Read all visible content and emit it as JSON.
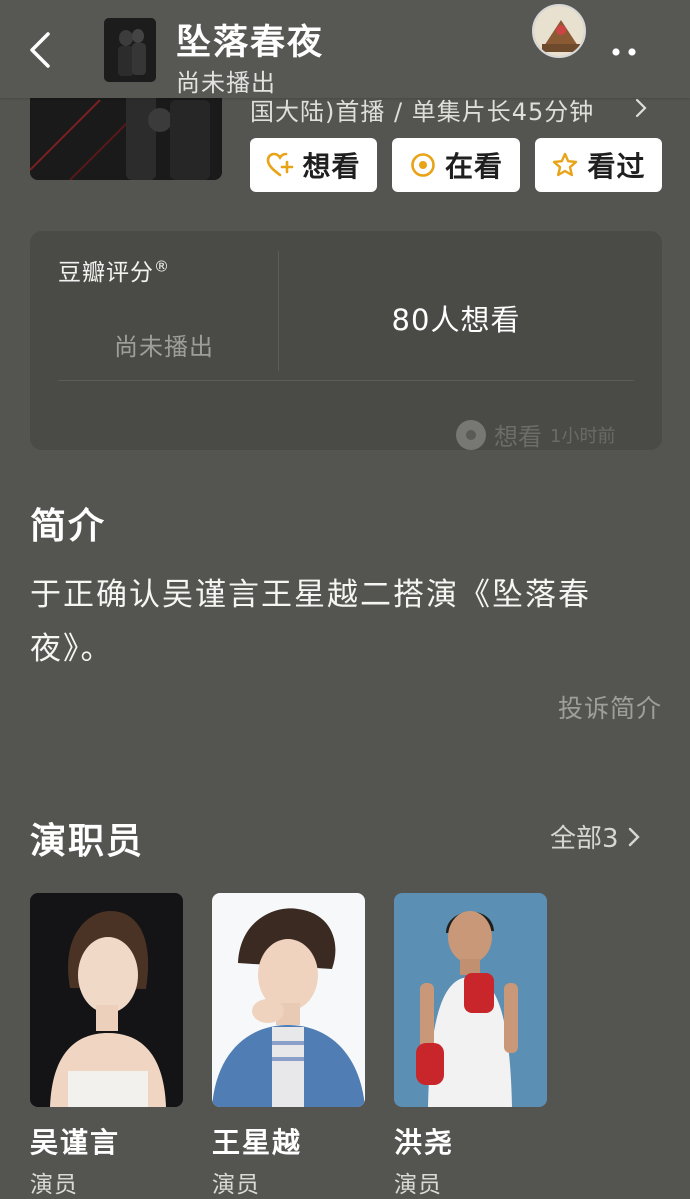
{
  "header": {
    "title": "坠落春夜",
    "subtitle": "尚未播出"
  },
  "info": {
    "meta_line": "国大陆)首播 / 单集片长45分钟",
    "buttons": {
      "want": "想看",
      "watching": "在看",
      "watched": "看过"
    }
  },
  "rating": {
    "label": "豆瓣评分",
    "registered": "®",
    "status": "尚未播出",
    "want_count": "80人想看",
    "activity_action": "想看",
    "activity_time": "1小时前"
  },
  "intro": {
    "title": "简介",
    "text": "于正确认吴谨言王星越二搭演《坠落春夜》。",
    "report_link": "投诉简介"
  },
  "cast": {
    "title": "演职员",
    "all_label": "全部3",
    "members": [
      {
        "name": "吴谨言",
        "role": "演员"
      },
      {
        "name": "王星越",
        "role": "演员"
      },
      {
        "name": "洪尧",
        "role": "演员"
      }
    ]
  },
  "colors": {
    "background": "#545451",
    "card": "#4a4a47",
    "button_bg": "#ffffff",
    "button_icon": "#e8a317",
    "muted_text": "#9d9d99"
  },
  "icons": [
    "back-arrow-icon",
    "more-dots-icon",
    "heart-plus-icon",
    "target-icon",
    "star-icon",
    "chevron-right-icon",
    "user-dot-icon"
  ]
}
